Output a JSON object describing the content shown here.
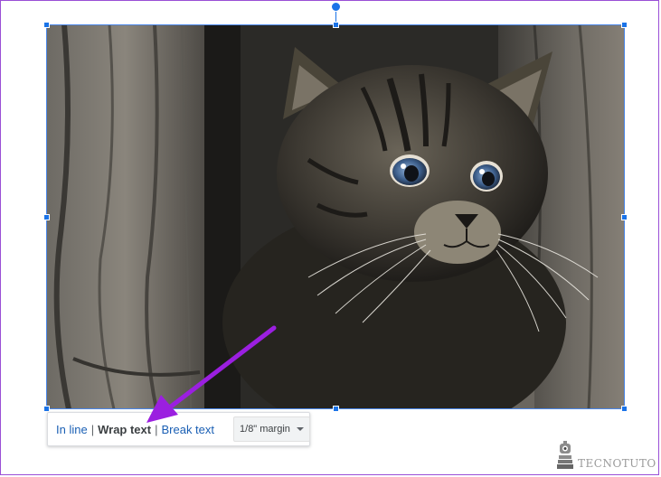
{
  "image": {
    "subject": "kitten-photo"
  },
  "wrap_toolbar": {
    "options": [
      {
        "label": "In line",
        "selected": false
      },
      {
        "label": "Wrap text",
        "selected": true
      },
      {
        "label": "Break text",
        "selected": false
      }
    ],
    "separator": "|",
    "margin_value": "1/8\" margin"
  },
  "annotation": {
    "arrow_color": "#9b1fe0"
  },
  "selection": {
    "handle_color": "#1a73e8"
  },
  "watermark": {
    "text": "TECNOTUTO",
    "icon": "robot-logo-icon"
  }
}
